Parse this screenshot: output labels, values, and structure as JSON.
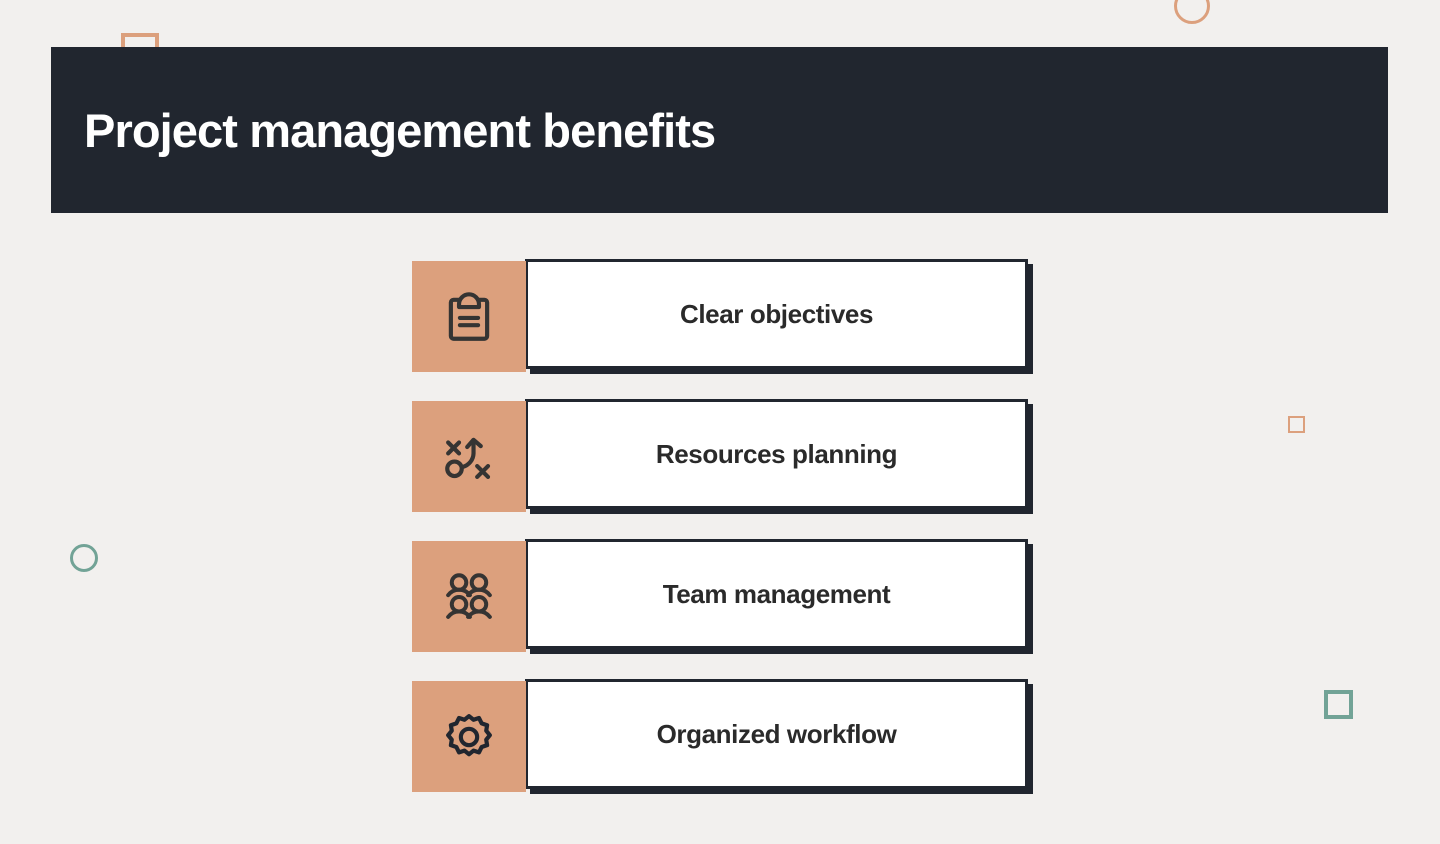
{
  "header": {
    "title": "Project management benefits"
  },
  "benefits": [
    {
      "label": "Clear objectives",
      "icon": "clipboard-icon"
    },
    {
      "label": "Resources planning",
      "icon": "strategy-icon"
    },
    {
      "label": "Team management",
      "icon": "users-four-icon"
    },
    {
      "label": "Organized workflow",
      "icon": "gear-icon"
    }
  ],
  "decorations": [
    {
      "name": "square-outline-orange-top",
      "shape": "square",
      "color": "#DCA07D"
    },
    {
      "name": "circle-outline-orange-top",
      "shape": "circle",
      "color": "#DCA07D"
    },
    {
      "name": "circle-outline-teal-left",
      "shape": "circle",
      "color": "#72A396"
    },
    {
      "name": "square-outline-orange-right",
      "shape": "square",
      "color": "#DCA07D"
    },
    {
      "name": "square-outline-teal-right",
      "shape": "square",
      "color": "#72A396"
    }
  ],
  "colors": {
    "background": "#F2F0EE",
    "banner": "#21262F",
    "banner_text": "#FFFFFF",
    "accent_orange": "#DCA07D",
    "accent_teal": "#72A396",
    "card_background": "#FFFFFF",
    "card_border": "#21262F",
    "card_text": "#2A2A2A",
    "icon_stroke": "#353433"
  }
}
